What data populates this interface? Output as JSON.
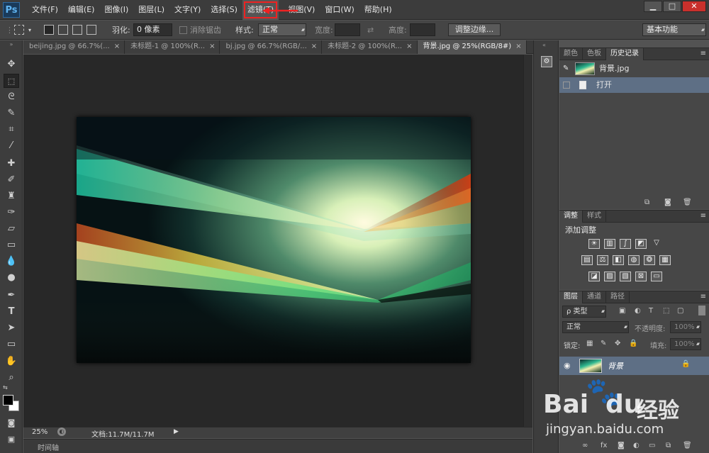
{
  "app": {
    "logo": "Ps"
  },
  "menubar": {
    "items": [
      "文件(F)",
      "编辑(E)",
      "图像(I)",
      "图层(L)",
      "文字(Y)",
      "选择(S)",
      "滤镜(T)",
      "视图(V)",
      "窗口(W)",
      "帮助(H)"
    ],
    "highlighted": "滤镜(T)",
    "window_buttons": {
      "minimize": "▁",
      "maximize": "□",
      "close": "✕"
    }
  },
  "options": {
    "feather_label": "羽化:",
    "feather_value": "0 像素",
    "antialias_label": "消除锯齿",
    "style_label": "样式:",
    "style_value": "正常",
    "width_label": "宽度:",
    "height_label": "高度:",
    "refine_edge": "调整边缘...",
    "workspace": "基本功能"
  },
  "tabs": [
    {
      "label": "beijing.jpg @ 66.7%(...",
      "close": "×",
      "active": false
    },
    {
      "label": "未标题-1 @ 100%(R...",
      "close": "×",
      "active": false
    },
    {
      "label": "bj.jpg @ 66.7%(RGB/...",
      "close": "×",
      "active": false
    },
    {
      "label": "未标题-2 @ 100%(R...",
      "close": "×",
      "active": false
    },
    {
      "label": "背景.jpg @ 25%(RGB/8#)",
      "close": "×",
      "active": true
    }
  ],
  "status": {
    "zoom": "25%",
    "doc": "文档:11.7M/11.7M",
    "timeline": "时间轴"
  },
  "history_panel": {
    "tabs": [
      "颜色",
      "色板",
      "历史记录"
    ],
    "active_tab": "历史记录",
    "snapshot": "背景.jpg",
    "steps": [
      "打开"
    ]
  },
  "adjust_panel": {
    "tabs": [
      "调整",
      "样式"
    ],
    "title": "添加调整"
  },
  "layers_panel": {
    "tabs": [
      "图层",
      "通道",
      "路径"
    ],
    "filter_label": "ρ 类型",
    "blend_mode": "正常",
    "opacity_label": "不透明度:",
    "opacity_value": "100%",
    "lock_label": "锁定:",
    "fill_label": "填充:",
    "fill_value": "100%",
    "layer_name": "背景"
  },
  "watermark": {
    "brand": "Bai",
    "brand2": "du",
    "brand3": "经验",
    "url": "jingyan.baidu.com"
  },
  "colors": {
    "accent_red": "#e22222",
    "selected_row": "#5e6f85"
  }
}
